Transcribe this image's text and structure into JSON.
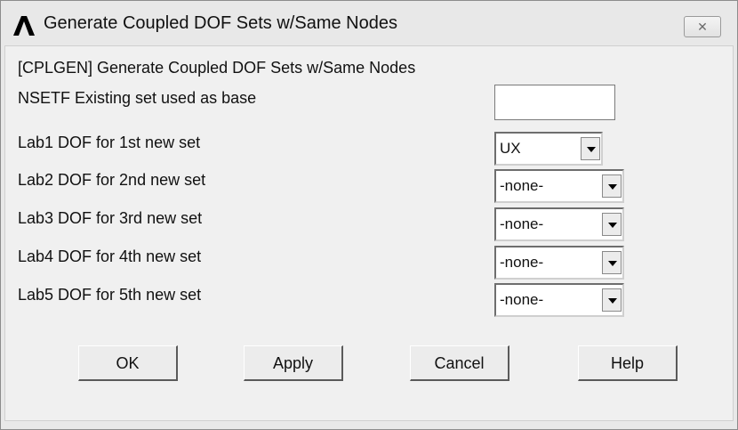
{
  "window": {
    "title": "Generate Coupled DOF Sets w/Same Nodes",
    "close_symbol": "✕"
  },
  "header_text": "[CPLGEN]  Generate Coupled DOF Sets w/Same Nodes",
  "nsetf": {
    "label": "NSETF  Existing set used as base",
    "value": ""
  },
  "rows": [
    {
      "label": "Lab1   DOF for 1st new set",
      "value": "UX"
    },
    {
      "label": "Lab2   DOF for 2nd new set",
      "value": "-none-"
    },
    {
      "label": "Lab3   DOF for 3rd new set",
      "value": "-none-"
    },
    {
      "label": "Lab4   DOF for 4th new set",
      "value": "-none-"
    },
    {
      "label": "Lab5   DOF for 5th new set",
      "value": "-none-"
    }
  ],
  "buttons": {
    "ok": "OK",
    "apply": "Apply",
    "cancel": "Cancel",
    "help": "Help"
  },
  "icons": {
    "app": "ansys-logo-icon",
    "close": "close-icon",
    "dropdown": "dropdown-arrow-icon"
  }
}
